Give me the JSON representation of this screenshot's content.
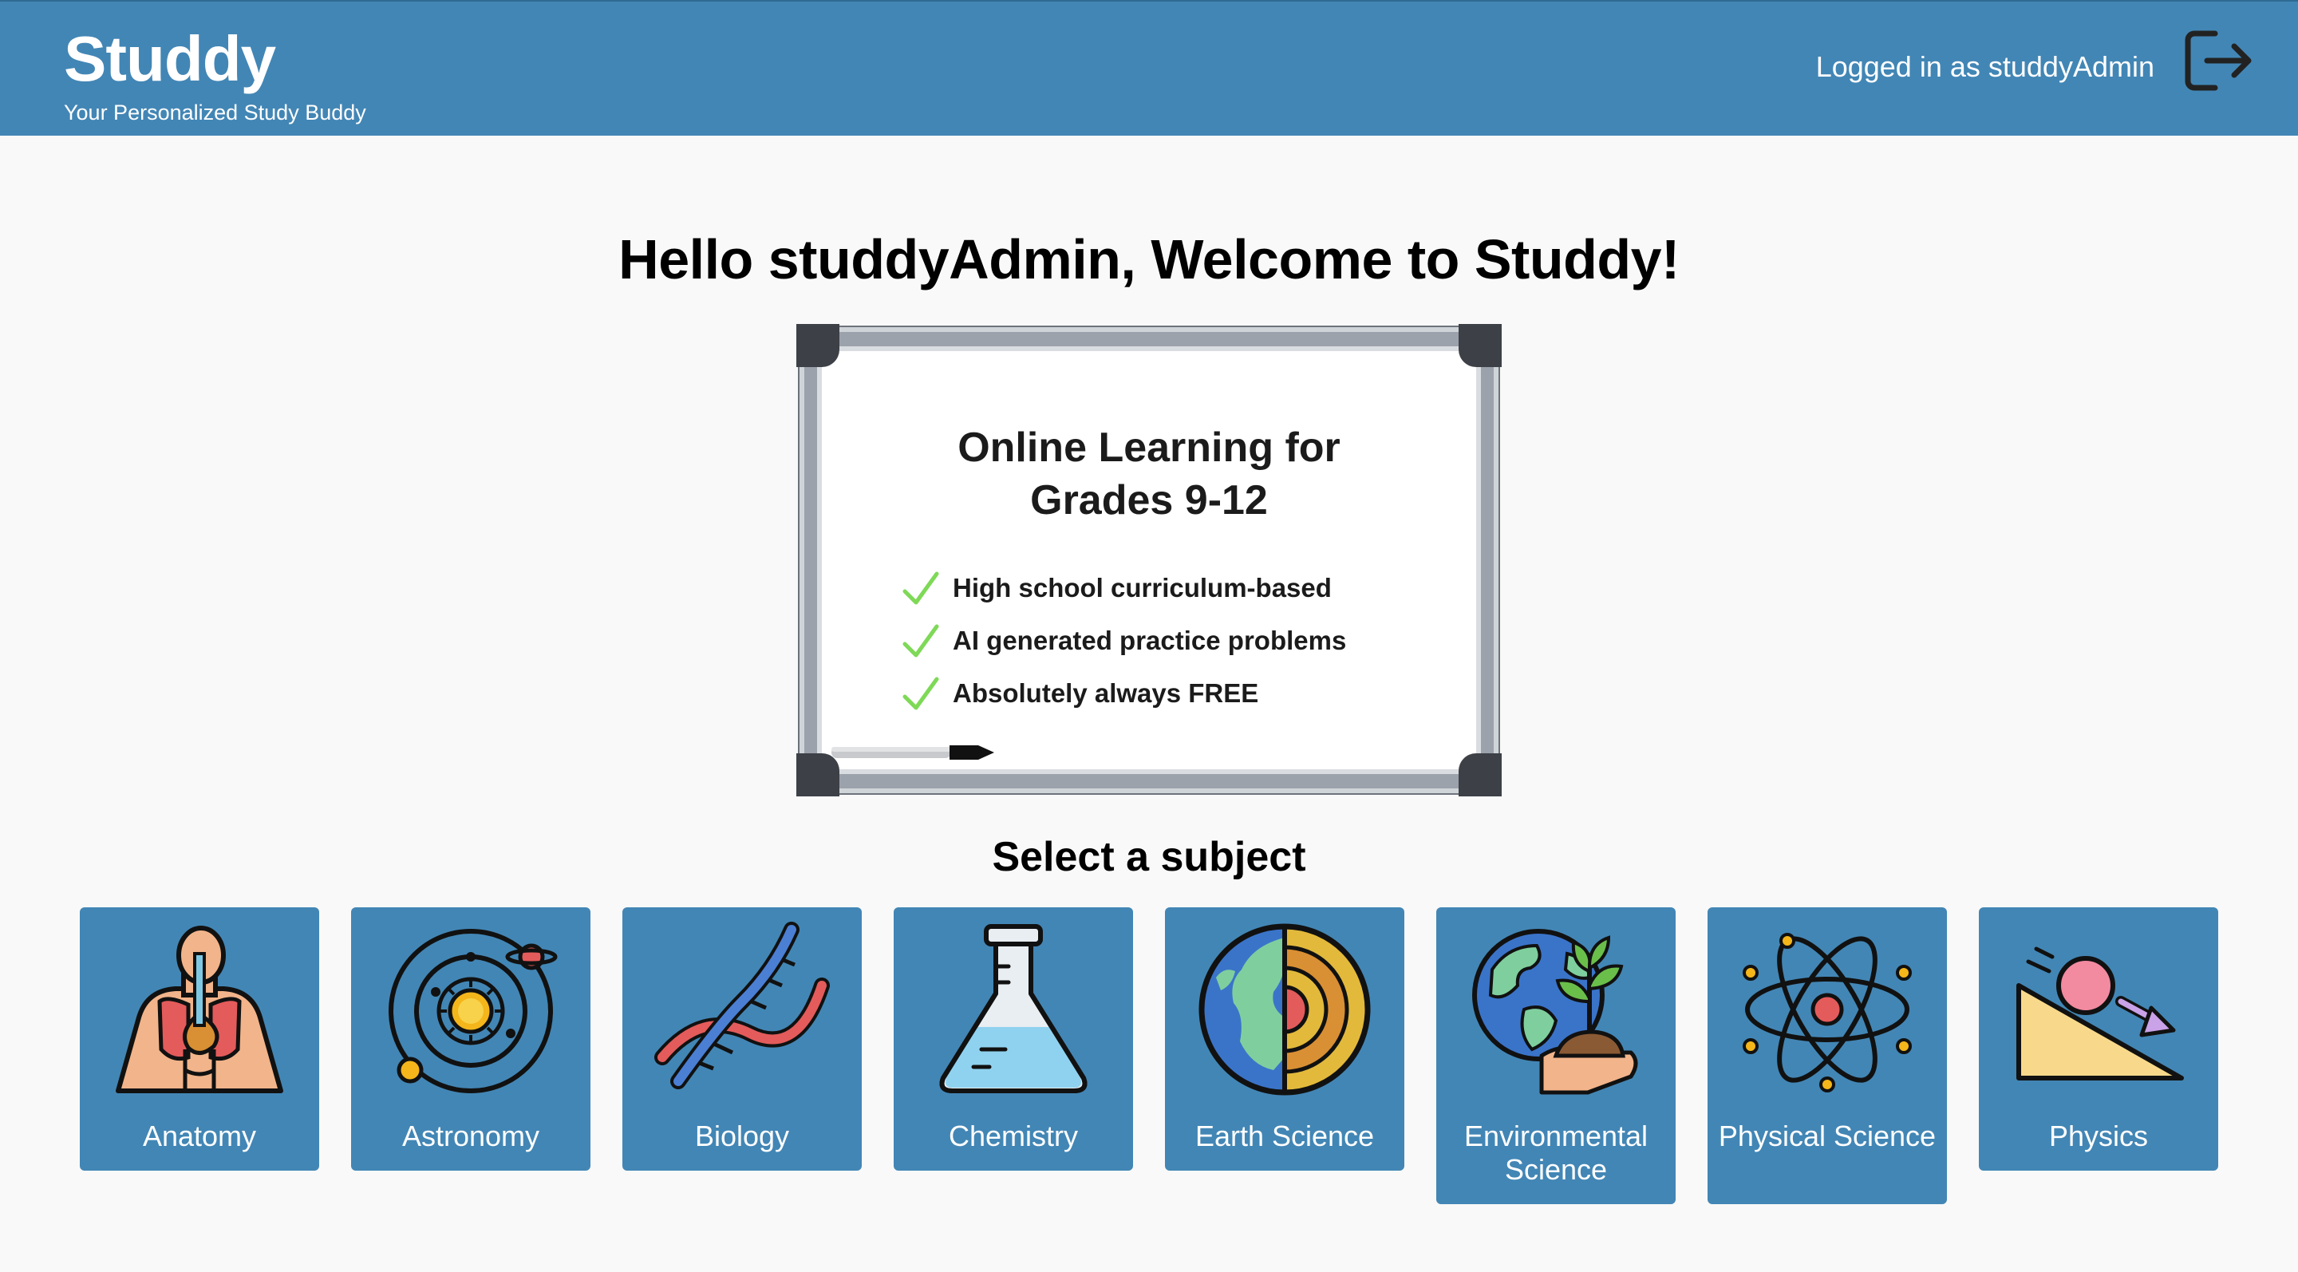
{
  "header": {
    "title": "Studdy",
    "tagline": "Your Personalized Study Buddy",
    "user_label": "Logged in as studdyAdmin",
    "logout_icon": "logout-icon"
  },
  "main": {
    "welcome": "Hello studdyAdmin, Welcome to Studdy!",
    "banner": {
      "title_line1": "Online Learning for",
      "title_line2": "Grades 9-12",
      "items": [
        "High school curriculum-based",
        "AI generated practice problems",
        "Absolutely always FREE"
      ]
    },
    "select_heading": "Select a subject",
    "subjects": [
      {
        "label": "Anatomy",
        "icon": "anatomy-icon"
      },
      {
        "label": "Astronomy",
        "icon": "solar-system-icon"
      },
      {
        "label": "Biology",
        "icon": "dna-icon"
      },
      {
        "label": "Chemistry",
        "icon": "flask-icon"
      },
      {
        "label": "Earth Science",
        "icon": "earth-layers-icon"
      },
      {
        "label": "Environmental Science",
        "icon": "globe-plant-icon"
      },
      {
        "label": "Physical Science",
        "icon": "atom-icon"
      },
      {
        "label": "Physics",
        "icon": "inclined-plane-icon"
      }
    ]
  },
  "colors": {
    "header_bg": "#4286b5",
    "card_bg": "#4286b5",
    "page_bg": "#f9f9f9",
    "check": "#7ed957"
  }
}
